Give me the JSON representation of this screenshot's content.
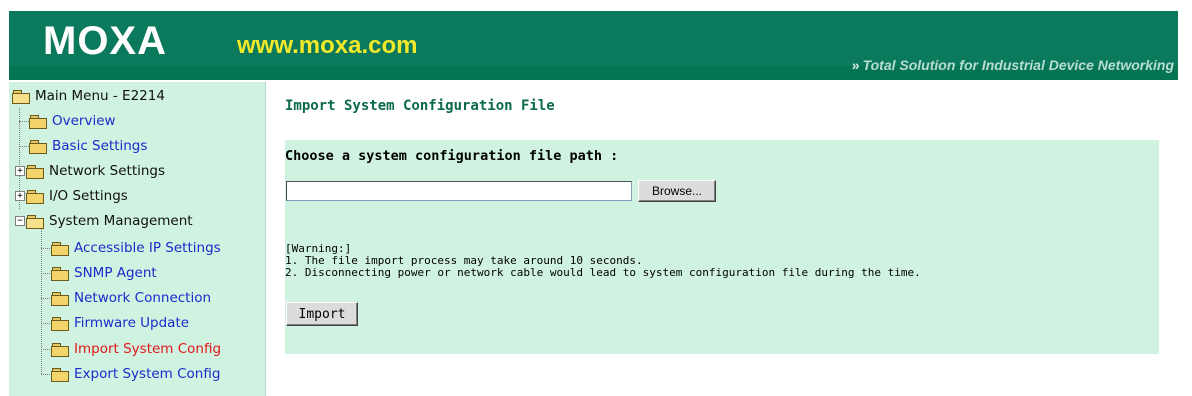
{
  "header": {
    "logo": "MOXA",
    "url": "www.moxa.com",
    "tagline": "Total Solution for Industrial Device Networking"
  },
  "sidebar": {
    "root": "Main Menu - E2214",
    "items": [
      {
        "label": "Overview",
        "type": "link"
      },
      {
        "label": "Basic Settings",
        "type": "link"
      },
      {
        "label": "Network Settings",
        "type": "group",
        "expanded": false
      },
      {
        "label": "I/O Settings",
        "type": "group",
        "expanded": false
      },
      {
        "label": "System Management",
        "type": "group",
        "expanded": true
      }
    ],
    "children": [
      {
        "label": "Accessible IP Settings",
        "active": false
      },
      {
        "label": "SNMP Agent",
        "active": false
      },
      {
        "label": "Network Connection",
        "active": false
      },
      {
        "label": "Firmware Update",
        "active": false
      },
      {
        "label": "Import System Config",
        "active": true
      },
      {
        "label": "Export System Config",
        "active": false
      }
    ],
    "colors": {
      "link": "#1b2bcb",
      "active": "#e01818",
      "background": "#cff2e1"
    }
  },
  "main": {
    "title": "Import System Configuration File",
    "panel": {
      "heading": "Choose a system configuration file path :",
      "file_value": "",
      "browse_label": "Browse...",
      "warning_title": "[Warning:]",
      "warning_lines": [
        "1. The file import process may take around 10 seconds.",
        "2. Disconnecting power or network cable would lead to system configuration file during the time."
      ],
      "import_label": "Import"
    }
  },
  "theme": {
    "header_green": "#0b7a5c",
    "url_yellow": "#f2e82a",
    "title_green": "#0b6a48",
    "panel_bg": "#cff2e1"
  }
}
